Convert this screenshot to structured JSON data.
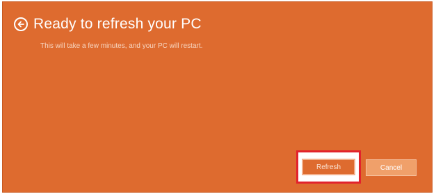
{
  "dialog": {
    "title": "Ready to refresh your PC",
    "subtitle": "This will take a few minutes, and your PC will restart.",
    "back_icon": "back-arrow-circle-icon",
    "background_color": "#de6b2f"
  },
  "buttons": {
    "refresh_label": "Refresh",
    "cancel_label": "Cancel",
    "highlight_color": "#e2232c"
  }
}
